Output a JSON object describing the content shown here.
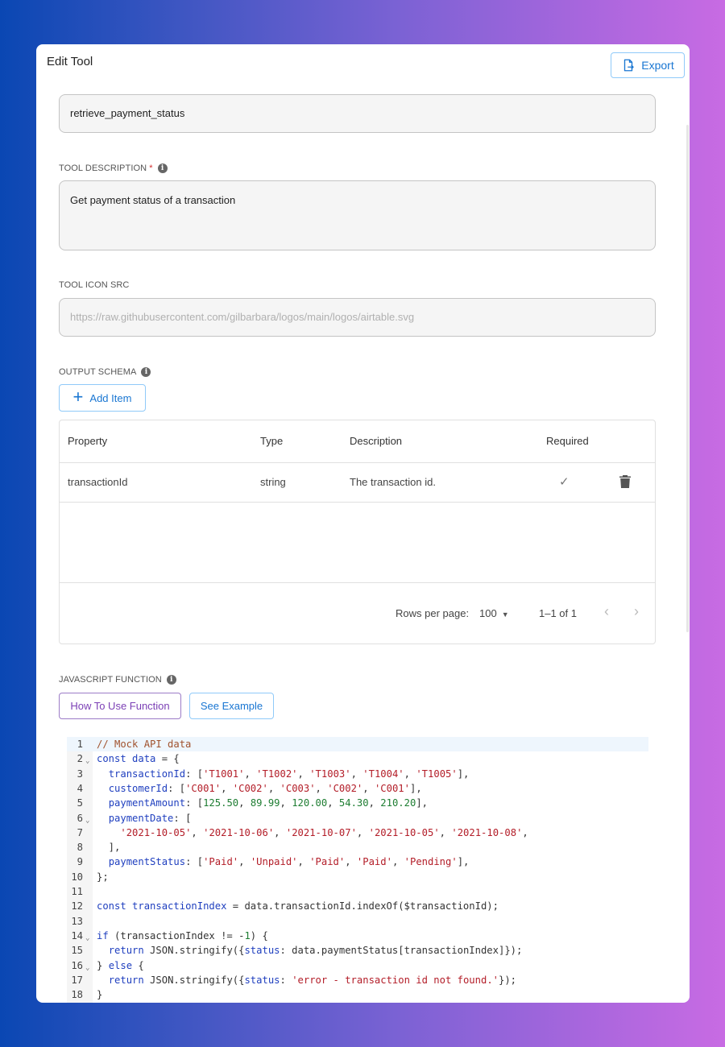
{
  "dialog": {
    "title": "Edit Tool",
    "export_label": "Export"
  },
  "tool": {
    "name": "retrieve_payment_status",
    "description_label": "TOOL DESCRIPTION",
    "description_required": "*",
    "description": "Get payment status of a transaction",
    "icon_label": "TOOL ICON SRC",
    "icon_placeholder": "https://raw.githubusercontent.com/gilbarbara/logos/main/logos/airtable.svg"
  },
  "output_schema": {
    "label": "OUTPUT SCHEMA",
    "add_item_label": "Add Item",
    "columns": [
      "Property",
      "Type",
      "Description",
      "Required"
    ],
    "rows": [
      {
        "property": "transactionId",
        "type": "string",
        "description": "The transaction id.",
        "required": true
      }
    ],
    "pagination": {
      "rows_per_page_label": "Rows per page:",
      "rows_per_page": "100",
      "range": "1–1 of 1"
    }
  },
  "javascript": {
    "label": "JAVASCRIPT FUNCTION",
    "how_to_label": "How To Use Function",
    "example_label": "See Example",
    "lines": [
      "// Mock API data",
      "const data = {",
      "  transactionId: ['T1001', 'T1002', 'T1003', 'T1004', 'T1005'],",
      "  customerId: ['C001', 'C002', 'C003', 'C002', 'C001'],",
      "  paymentAmount: [125.50, 89.99, 120.00, 54.30, 210.20],",
      "  paymentDate: [",
      "    '2021-10-05', '2021-10-06', '2021-10-07', '2021-10-05', '2021-10-08',",
      "  ],",
      "  paymentStatus: ['Paid', 'Unpaid', 'Paid', 'Paid', 'Pending'],",
      "};",
      "",
      "const transactionIndex = data.transactionId.indexOf($transactionId);",
      "",
      "if (transactionIndex != -1) {",
      "  return JSON.stringify({status: data.paymentStatus[transactionIndex]});",
      "} else {",
      "  return JSON.stringify({status: 'error - transaction id not found.'});",
      "}"
    ],
    "fold_lines": [
      2,
      6,
      14,
      16
    ]
  }
}
